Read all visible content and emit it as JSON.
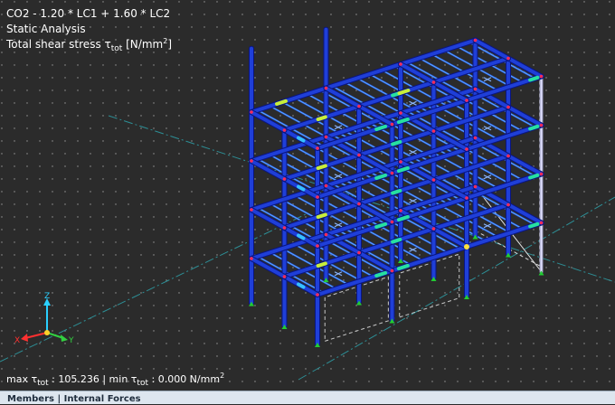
{
  "overlay": {
    "load_combo": "CO2 - 1.20 * LC1 + 1.60 * LC2",
    "analysis": "Static Analysis",
    "result_label": "Total shear stress τ",
    "result_sub": "tot",
    "result_unit_pre": " [N/mm",
    "result_unit_sup": "2",
    "result_unit_post": "]"
  },
  "minmax": {
    "max_label": "max τ",
    "sub": "tot",
    "max_value": " : 105.236 | min τ",
    "min_value": " : 0.000 N/mm",
    "sup": "2"
  },
  "axes": {
    "x": "X",
    "y": "Y",
    "z": "Z"
  },
  "panel": {
    "title": "Members | Internal Forces"
  },
  "colors": {
    "background": "#2b2b2b",
    "member": "#1f3fd8",
    "member_outline": "#0a1580",
    "beam_highlight": "#3ec4ff",
    "stress_high": "#c8ee3a",
    "stress_mid": "#27e0a0",
    "support": "#22cc33",
    "node": "#ff2a55",
    "panel_bg": "#dde6ef"
  }
}
